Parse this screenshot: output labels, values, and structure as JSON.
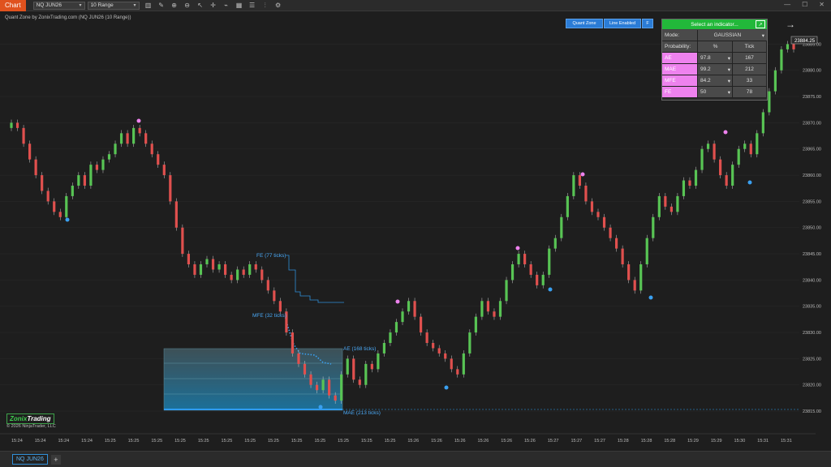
{
  "toolbar": {
    "chart_tab": "Chart",
    "instrument": "NQ JUN26",
    "bar_type": "10 Range",
    "tools": [
      "bar-icon",
      "pencil-icon",
      "zoom-in-icon",
      "zoom-out-icon",
      "cursor-icon",
      "crosshair-icon",
      "draw-icon",
      "template-icon",
      "properties-icon",
      "indicator-icon",
      "strategy-icon"
    ]
  },
  "chart_title": "Quant Zone by ZonixTrading.com (NQ JUN26 (10 Range))",
  "quant_buttons": {
    "quant_zone": "Quant Zone",
    "line_enabled": "Line Enabled",
    "f": "F"
  },
  "panel": {
    "header": "Select an indicator...",
    "mode_label": "Mode:",
    "mode_value": "GAUSSIAN",
    "prob_label": "Probability:",
    "col_pct": "%",
    "col_tick": "Tick",
    "rows": [
      {
        "name": "AE",
        "pct": "97.8",
        "tick": "167"
      },
      {
        "name": "MAE",
        "pct": "99.2",
        "tick": "212"
      },
      {
        "name": "MFE",
        "pct": "84.2",
        "tick": "33"
      },
      {
        "name": "FE",
        "pct": "50",
        "tick": "78"
      }
    ]
  },
  "annotations": {
    "fe": "FE (77 ticks)",
    "mfe": "MFE (32 ticks)",
    "ae": "AE (168 ticks)",
    "mae": "MAE (213 ticks)"
  },
  "price_axis": {
    "current": "23884.25",
    "labels": [
      "23885.00",
      "23880.00",
      "23875.00",
      "23870.00",
      "23865.00",
      "23860.00",
      "23855.00",
      "23850.00",
      "23845.00",
      "23840.00",
      "23835.00",
      "23830.00",
      "23825.00",
      "23820.00",
      "23815.00"
    ]
  },
  "time_axis": [
    "15:24",
    "15:24",
    "15:24",
    "15:24",
    "15:25",
    "15:25",
    "15:25",
    "15:25",
    "15:25",
    "15:25",
    "15:25",
    "15:25",
    "15:25",
    "15:25",
    "15:25",
    "15:25",
    "15:25",
    "15:26",
    "15:26",
    "15:26",
    "15:26",
    "15:26",
    "15:26",
    "15:27",
    "15:27",
    "15:27",
    "15:28",
    "15:28",
    "15:28",
    "15:29",
    "15:29",
    "15:30",
    "15:31",
    "15:31"
  ],
  "logo": {
    "zonix": "Zonix",
    "trading": "Trading"
  },
  "copyright": "© 2026 NinjaTrader, LLC",
  "bottom_tab": "NQ JUN26",
  "colors": {
    "up": "#58c454",
    "down": "#e0504e",
    "accent": "#2b7cd6",
    "panel_green": "#22b83a",
    "pink": "#ee82ee"
  },
  "chart_data": {
    "type": "candlestick",
    "y_range": [
      23813,
      23888
    ],
    "closes": [
      23870,
      23869,
      23866,
      23863,
      23860,
      23857,
      23855,
      23853,
      23852,
      23856,
      23858,
      23860,
      23858,
      23862,
      23861,
      23863,
      23864,
      23866,
      23868,
      23866,
      23869,
      23868,
      23866,
      23864,
      23862,
      23860,
      23855,
      23850,
      23845,
      23843,
      23841,
      23843,
      23844,
      23842,
      23843,
      23841,
      23840,
      23842,
      23841,
      23843,
      23842,
      23840,
      23838,
      23836,
      23834,
      23830,
      23826,
      23824,
      23822,
      23820,
      23819,
      23821,
      23818,
      23817,
      23822,
      23825,
      23821,
      23820,
      23824,
      23823,
      23826,
      23828,
      23830,
      23832,
      23834,
      23836,
      23833,
      23830,
      23828,
      23827,
      23826,
      23825,
      23823,
      23822,
      23826,
      23830,
      23833,
      23836,
      23834,
      23833,
      23836,
      23840,
      23843,
      23845,
      23843,
      23841,
      23839,
      23841,
      23846,
      23848,
      23852,
      23856,
      23860,
      23858,
      23855,
      23853,
      23852,
      23850,
      23848,
      23846,
      23843,
      23840,
      23838,
      23843,
      23848,
      23852,
      23856,
      23854,
      23853,
      23856,
      23859,
      23858,
      23861,
      23865,
      23866,
      23863,
      23860,
      23858,
      23862,
      23865,
      23866,
      23864,
      23868,
      23872,
      23876,
      23880,
      23884,
      23885,
      23884
    ]
  }
}
